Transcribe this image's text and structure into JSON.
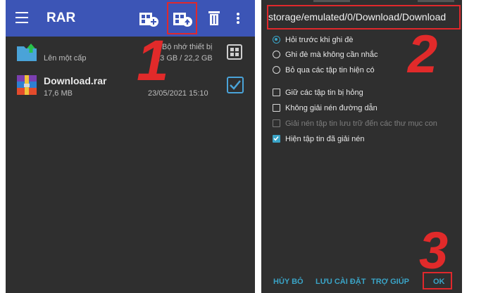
{
  "app": {
    "title": "RAR"
  },
  "toolbar": {
    "menu_icon": "hamburger-menu-icon",
    "archive_icon": "add-to-archive-icon",
    "extract_icon": "extract-from-archive-icon",
    "delete_icon": "trash-icon",
    "more_icon": "more-vert-icon"
  },
  "file_list": {
    "up_row": {
      "label": "Lên một cấp",
      "storage": "Bộ nhớ thiết bị",
      "size": "3,3 GB / 22,2 GB"
    },
    "file_row": {
      "name": "Download.rar",
      "size": "17,6 MB",
      "date": "23/05/2021 15:10"
    }
  },
  "dialog": {
    "destination_path": "storage/emulated/0/Download/Download",
    "overwrite_options": [
      {
        "label": "Hỏi trước khi ghi đè",
        "selected": true
      },
      {
        "label": "Ghi đè mà không cần nhắc",
        "selected": false
      },
      {
        "label": "Bỏ qua các tập tin hiện có",
        "selected": false
      }
    ],
    "checkbox_options": [
      {
        "label": "Giữ các tập tin bị hỏng",
        "checked": false,
        "disabled": false
      },
      {
        "label": "Không giải nén đường dẫn",
        "checked": false,
        "disabled": false
      },
      {
        "label": "Giải nén tập tin lưu trữ đến các thư mục con",
        "checked": false,
        "disabled": true
      },
      {
        "label": "Hiện tập tin đã giải nén",
        "checked": true,
        "disabled": false
      }
    ],
    "buttons": {
      "cancel": "HỦY BỎ",
      "save_settings": "LƯU CÀI ĐẶT",
      "help": "TRỢ GIÚP",
      "ok": "OK"
    }
  },
  "annotations": {
    "step1": "1",
    "step2": "2",
    "step3": "3"
  },
  "colors": {
    "toolbar_blue": "#3c55b6",
    "accent": "#3aa4c7",
    "annotation_red": "#e12a2a",
    "panel_bg": "#2f2f2f"
  }
}
